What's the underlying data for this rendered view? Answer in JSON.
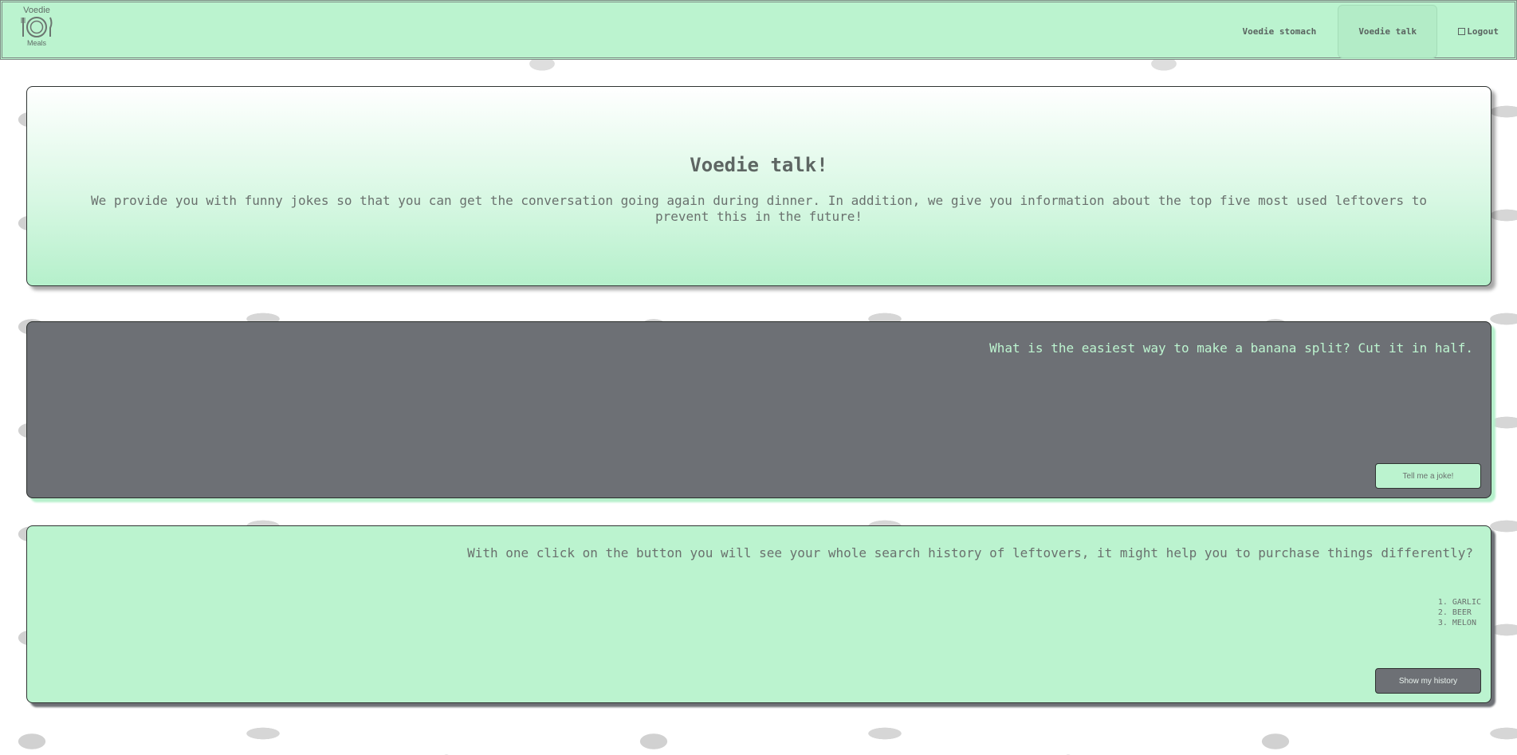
{
  "header": {
    "logo": {
      "top_text": "Voedie",
      "bottom_text": "Meals",
      "icon": "plate-fork-knife-icon"
    },
    "nav": [
      {
        "label": "Voedie stomach",
        "active": false
      },
      {
        "label": "Voedie talk",
        "active": true
      },
      {
        "label": "Logout",
        "icon": "logout-icon",
        "active": false
      }
    ]
  },
  "hero": {
    "title": "Voedie talk!",
    "description": "We provide you with funny jokes so that you can get the conversation going again during dinner. In addition, we give you information about the top five most used leftovers to prevent this in the future!"
  },
  "joke_card": {
    "joke": "What is the easiest way to make a banana split? Cut it in half.",
    "button_label": "Tell me a joke!"
  },
  "history_card": {
    "intro": "With one click on the button you will see your whole search history of leftovers, it might help you to purchase things differently?",
    "items": [
      "GARLIC",
      "BEER",
      "MELON"
    ],
    "button_label": "Show my history"
  },
  "colors": {
    "mint": "#bbf3cf",
    "slate": "#6d7075",
    "text_gray": "#6a716e"
  }
}
